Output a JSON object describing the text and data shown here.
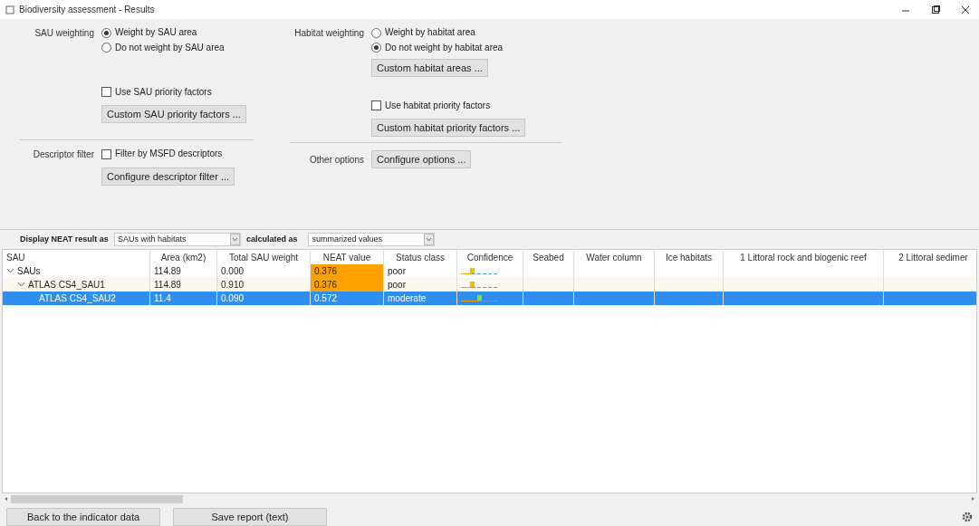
{
  "window": {
    "title": "Biodiversity assessment - Results"
  },
  "sau_weighting": {
    "label": "SAU weighting",
    "options": [
      {
        "label": "Weight by SAU area",
        "selected": true
      },
      {
        "label": "Do not weight by SAU area",
        "selected": false
      }
    ],
    "priority_checkbox": {
      "label": "Use SAU priority factors",
      "checked": false
    },
    "button": "Custom SAU priority factors ..."
  },
  "habitat_weighting": {
    "label": "Habitat weighting",
    "options": [
      {
        "label": "Weight by habitat area",
        "selected": false
      },
      {
        "label": "Do not weight by habitat area",
        "selected": true
      }
    ],
    "areas_button": "Custom habitat areas ...",
    "priority_checkbox": {
      "label": "Use habitat priority factors",
      "checked": false
    },
    "button": "Custom habitat priority factors ..."
  },
  "descriptor_filter": {
    "label": "Descriptor filter",
    "checkbox": {
      "label": "Filter by MSFD descriptors",
      "checked": false
    },
    "button": "Configure descriptor filter ..."
  },
  "other_options": {
    "label": "Other options",
    "button": "Configure options ..."
  },
  "display": {
    "label": "Display NEAT result as",
    "value": "SAUs with habitats",
    "calc_label": "calculated as",
    "calc_value": "summarized values"
  },
  "table": {
    "columns": [
      "SAU",
      "Area (km2)",
      "Total SAU weight",
      "NEAT value",
      "Status class",
      "Confidence",
      "Seabed",
      "Water column",
      "Ice habitats",
      "1 Littoral rock and biogenic reef",
      "2 Littoral sedimer"
    ],
    "rows": [
      {
        "sau": "SAUs",
        "area": "114.89",
        "weight": "0.000",
        "neat": "0.376",
        "status": "poor",
        "color": "#ffa200",
        "kind": "left",
        "expanded": true,
        "selected": false,
        "children": [
          {
            "sau": "ATLAS CS4_SAU1",
            "area": "114.89",
            "weight": "0.910",
            "neat": "0.376",
            "status": "poor",
            "color": "#ffa200",
            "kind": "left",
            "expanded": true,
            "selected": false,
            "children": [
              {
                "sau": "ATLAS CS4_SAU2",
                "area": "11.4",
                "weight": "0.090",
                "neat": "0.572",
                "status": "moderate",
                "kind": "middle",
                "selected": true
              }
            ]
          }
        ]
      }
    ]
  },
  "buttons": [
    "Back to the indicator data",
    "Save report (text)"
  ]
}
